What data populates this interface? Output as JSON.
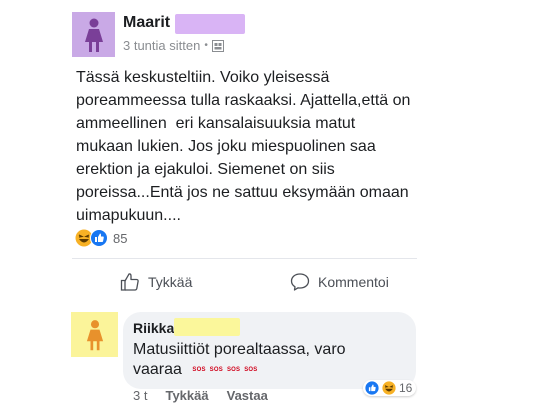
{
  "post": {
    "author": "Maarit",
    "time": "3 tuntia sitten",
    "separator": "•",
    "privacy_icon": "group-privacy-icon",
    "text": "Tässä keskusteltiin. Voiko yleisessä\nporeammeessa tulla raskaaksi. Ajattella,että on\nammeellinen  eri kansalaisuuksia matut\nmukaan lukien. Jos joku miespuolinen saa\nerektion ja ejakuloi. Siemenet on siis\nporeissa...Entä jos ne sattuu eksymään omaan\nuimapukuun....",
    "reaction_count": "85",
    "avatar_color": "#c9a9e6"
  },
  "actions": {
    "like_label": "Tykkää",
    "comment_label": "Kommentoi"
  },
  "comment": {
    "author": "Riikka",
    "text": "Matusiittiöt porealtaassa, varo vaaraa",
    "sos_labels": [
      "SOS",
      "SOS",
      "SOS",
      "SOS"
    ],
    "reaction_count": "16",
    "time": "3 t",
    "like_label": "Tykkää",
    "reply_label": "Vastaa",
    "avatar_color": "#fbf49a"
  }
}
